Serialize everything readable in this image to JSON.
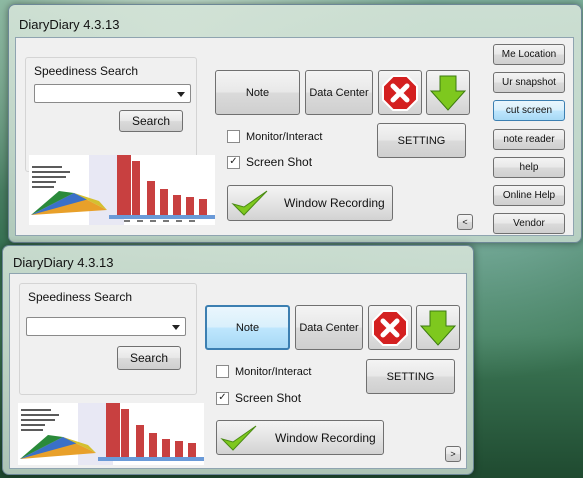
{
  "window1": {
    "title": "DiaryDiary 4.3.13",
    "speediness_search": {
      "label": "Speediness Search",
      "combo_value": "",
      "search_button": "Search"
    },
    "buttons": {
      "note": "Note",
      "data_center": "Data Center",
      "setting": "SETTING",
      "window_recording": "Window Recording",
      "collapse": "<"
    },
    "checkboxes": {
      "monitor_interact": {
        "label": "Monitor/Interact",
        "checked": false
      },
      "screen_shot": {
        "label": "Screen Shot",
        "checked": true
      }
    },
    "side_menu": [
      {
        "label": "Me Location"
      },
      {
        "label": "Ur snapshot"
      },
      {
        "label": "cut screen"
      },
      {
        "label": "note reader"
      },
      {
        "label": "help"
      },
      {
        "label": "Online Help"
      },
      {
        "label": "Vendor"
      }
    ]
  },
  "window2": {
    "title": "DiaryDiary 4.3.13",
    "speediness_search": {
      "label": "Speediness Search",
      "combo_value": "",
      "search_button": "Search"
    },
    "buttons": {
      "note": "Note",
      "data_center": "Data Center",
      "setting": "SETTING",
      "window_recording": "Window Recording",
      "expand": ">"
    },
    "checkboxes": {
      "monitor_interact": {
        "label": "Monitor/Interact",
        "checked": false
      },
      "screen_shot": {
        "label": "Screen Shot",
        "checked": true
      }
    }
  },
  "icons": {
    "close": "close-icon",
    "down_arrow": "down-arrow-icon",
    "checkmark": "checkmark-icon"
  },
  "colors": {
    "close_red": "#d42020",
    "arrow_green": "#7ec81e",
    "selected_blue": "#bee6fd"
  }
}
